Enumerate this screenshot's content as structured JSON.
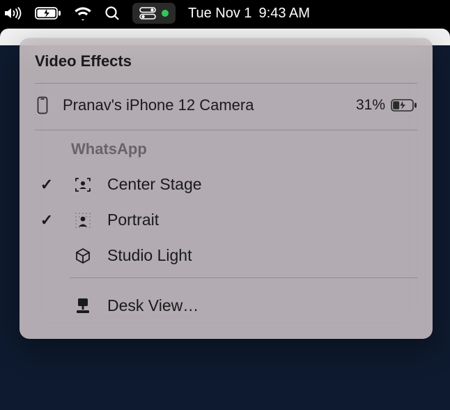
{
  "menubar": {
    "date": "Tue Nov 1",
    "time": "9:43 AM",
    "camera_indicator": true
  },
  "popover": {
    "title": "Video Effects",
    "device": {
      "name": "Pranav's iPhone 12 Camera",
      "battery_label": "31%",
      "battery_icon": "charging"
    },
    "app_section": "WhatsApp",
    "effects": [
      {
        "label": "Center Stage",
        "checked": true,
        "icon": "center-stage"
      },
      {
        "label": "Portrait",
        "checked": true,
        "icon": "portrait"
      },
      {
        "label": "Studio Light",
        "checked": false,
        "icon": "studio-light"
      }
    ],
    "extra": {
      "label": "Desk View…",
      "icon": "desk-view"
    }
  }
}
